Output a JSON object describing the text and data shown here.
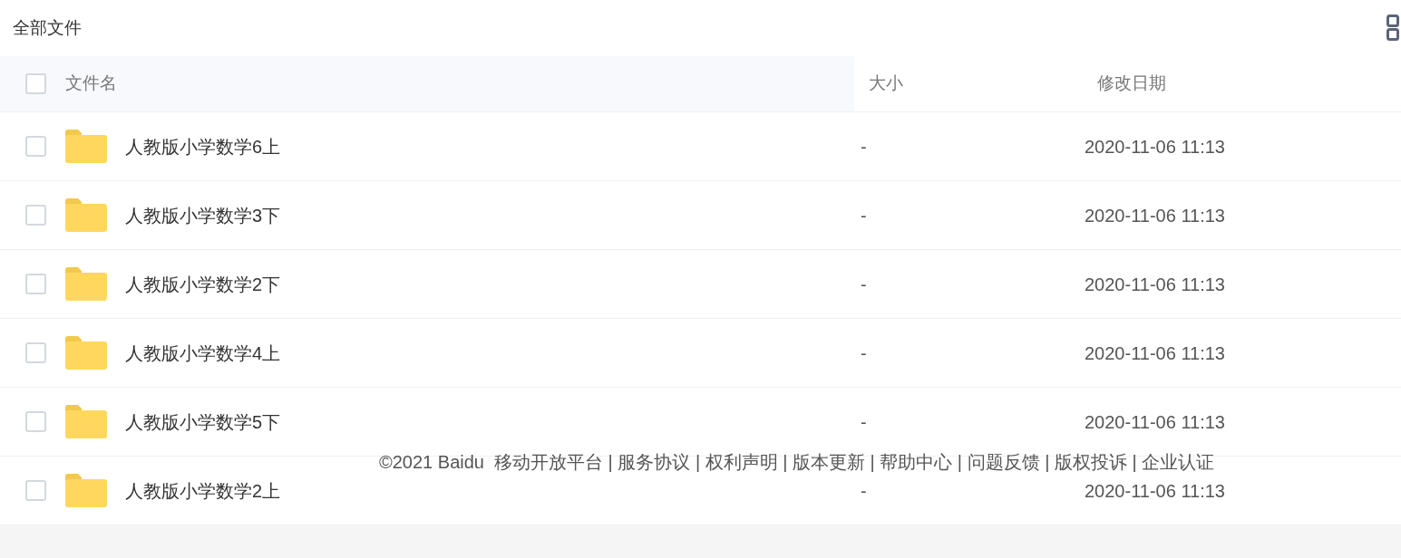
{
  "title": "全部文件",
  "table": {
    "columns": [
      {
        "label": "文件名"
      },
      {
        "label": "大小"
      },
      {
        "label": "修改日期"
      }
    ],
    "select_all": {
      "checked": false
    },
    "rows": [
      {
        "name": "人教版小学数学6上",
        "size": "-",
        "modified": "2020-11-06 11:13",
        "checked": false
      },
      {
        "name": "人教版小学数学3下",
        "size": "-",
        "modified": "2020-11-06 11:13",
        "checked": false
      },
      {
        "name": "人教版小学数学2下",
        "size": "-",
        "modified": "2020-11-06 11:13",
        "checked": false
      },
      {
        "name": "人教版小学数学4上",
        "size": "-",
        "modified": "2020-11-06 11:13",
        "checked": false
      },
      {
        "name": "人教版小学数学5下",
        "size": "-",
        "modified": "2020-11-06 11:13",
        "checked": false
      },
      {
        "name": "人教版小学数学2上",
        "size": "-",
        "modified": "2020-11-06 11:13",
        "checked": false
      }
    ]
  },
  "footer": "©2021 Baidu  移动开放平台 | 服务协议 | 权利声明 | 版本更新 | 帮助中心 | 问题反馈 | 版权投诉 | 企业认证"
}
